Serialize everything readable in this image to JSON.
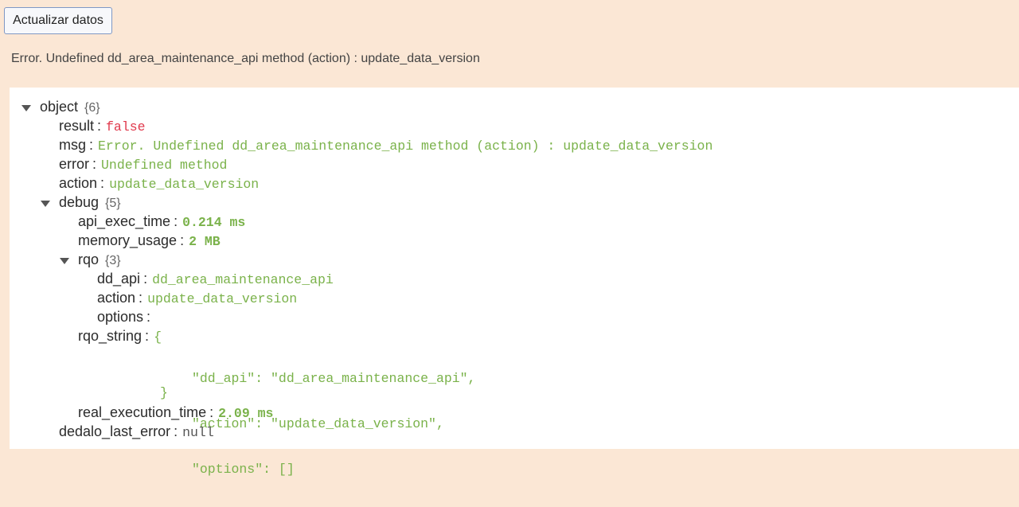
{
  "toolbar": {
    "update_button": "Actualizar datos"
  },
  "error_message": "Error. Undefined dd_area_maintenance_api method (action) : update_data_version",
  "tree": {
    "root": {
      "key": "object",
      "count": "{6}"
    },
    "result": {
      "key": "result",
      "value": "false"
    },
    "msg": {
      "key": "msg",
      "value": "Error. Undefined dd_area_maintenance_api method (action) : update_data_version"
    },
    "error": {
      "key": "error",
      "value": "Undefined method"
    },
    "action": {
      "key": "action",
      "value": "update_data_version"
    },
    "debug": {
      "key": "debug",
      "count": "{5}",
      "api_exec_time": {
        "key": "api_exec_time",
        "value": "0.214 ms"
      },
      "memory_usage": {
        "key": "memory_usage",
        "value": "2 MB"
      },
      "rqo": {
        "key": "rqo",
        "count": "{3}",
        "dd_api": {
          "key": "dd_api",
          "value": "dd_area_maintenance_api"
        },
        "action": {
          "key": "action",
          "value": "update_data_version"
        },
        "options": {
          "key": "options",
          "value": ""
        }
      },
      "rqo_string": {
        "key": "rqo_string",
        "open": "{",
        "lines": [
          "\"dd_api\": \"dd_area_maintenance_api\",",
          "\"action\": \"update_data_version\",",
          "\"options\": []"
        ],
        "close": "}"
      },
      "real_execution_time": {
        "key": "real_execution_time",
        "value": "2.09 ms"
      }
    },
    "dedalo_last_error": {
      "key": "dedalo_last_error",
      "value": "null"
    }
  }
}
